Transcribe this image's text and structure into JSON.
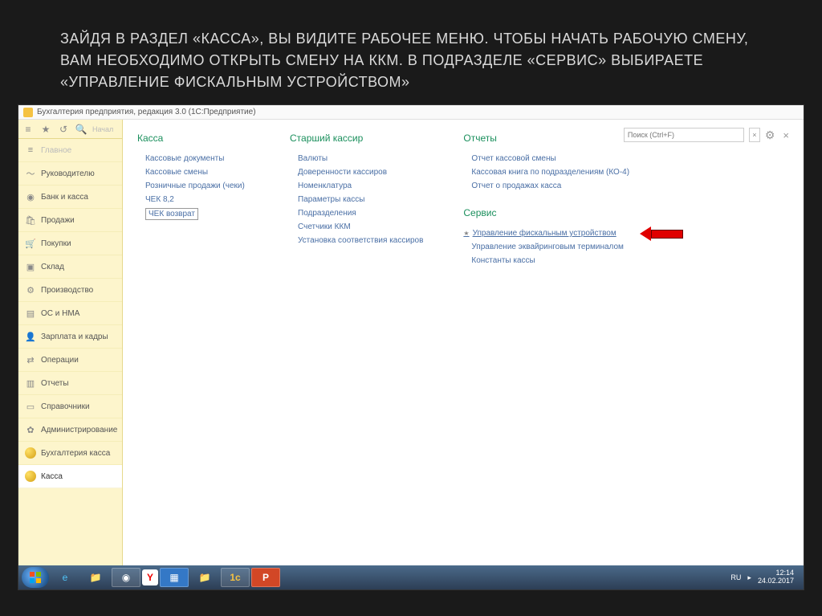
{
  "slide": {
    "title": "ЗАЙДЯ В РАЗДЕЛ «КАССА», ВЫ ВИДИТЕ РАБОЧЕЕ МЕНЮ. ЧТОБЫ НАЧАТЬ РАБОЧУЮ СМЕНУ, ВАМ НЕОБХОДИМО ОТКРЫТЬ СМЕНУ НА ККМ. В ПОДРАЗДЕЛЕ «СЕРВИС» ВЫБИРАЕТЕ «УПРАВЛЕНИЕ ФИСКАЛЬНЫМ УСТРОЙСТВОМ»"
  },
  "window": {
    "title": "Бухгалтерия предприятия, редакция 3.0  (1С:Предприятие)"
  },
  "search": {
    "placeholder": "Поиск (Ctrl+F)"
  },
  "sidebar": {
    "start": "Начал",
    "items": [
      {
        "label": "Главное"
      },
      {
        "label": "Руководителю"
      },
      {
        "label": "Банк и касса"
      },
      {
        "label": "Продажи"
      },
      {
        "label": "Покупки"
      },
      {
        "label": "Склад"
      },
      {
        "label": "Производство"
      },
      {
        "label": "ОС и НМА"
      },
      {
        "label": "Зарплата и кадры"
      },
      {
        "label": "Операции"
      },
      {
        "label": "Отчеты"
      },
      {
        "label": "Справочники"
      },
      {
        "label": "Администрирование"
      },
      {
        "label": "Бухгалтерия касса"
      },
      {
        "label": "Касса"
      }
    ]
  },
  "columns": {
    "kassa": {
      "title": "Касса",
      "items": [
        "Кассовые документы",
        "Кассовые смены",
        "Розничные продажи (чеки)",
        "ЧЕК 8,2",
        "ЧЕК возврат"
      ]
    },
    "senior": {
      "title": "Старший кассир",
      "items": [
        "Валюты",
        "Доверенности кассиров",
        "Номенклатура",
        "Параметры кассы",
        "Подразделения",
        "Счетчики ККМ",
        "Установка соответствия кассиров"
      ]
    },
    "reports": {
      "title": "Отчеты",
      "items": [
        "Отчет кассовой смены",
        "Кассовая книга по подразделениям (КО-4)",
        "Отчет о продажах касса"
      ]
    },
    "service": {
      "title": "Сервис",
      "items": [
        "Управление фискальным устройством",
        "Управление эквайринговым терминалом",
        "Константы кассы"
      ]
    }
  },
  "taskbar": {
    "lang": "RU",
    "time": "12:14",
    "date": "24.02.2017"
  }
}
